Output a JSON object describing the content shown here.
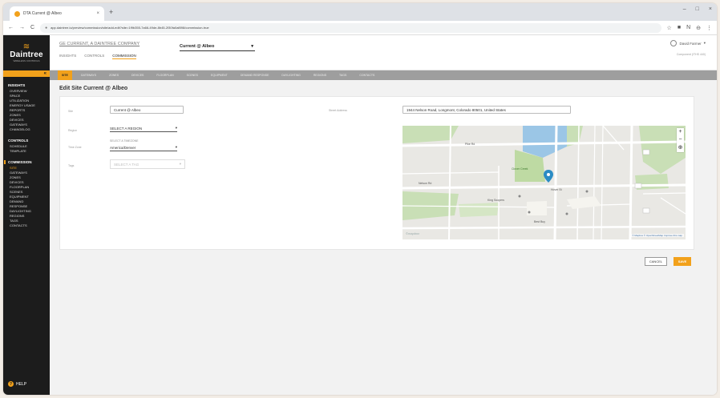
{
  "browser": {
    "tab_title": "DTA Current @ Albeo",
    "tab_close": "×",
    "new_tab": "+",
    "window_controls": [
      "–",
      "□",
      "×"
    ],
    "url": "app.daintree.io/preview/commission/site/add-edit?site=1f9b355-7a66-49de-8b45-2f30fa0af898/commission-true",
    "right_icons": [
      "☆",
      "■",
      "N",
      "⊖",
      "⋮"
    ],
    "nav_icons": [
      "←",
      "→",
      "C"
    ]
  },
  "sidebar": {
    "logo_mark": "≋",
    "brand": "Daintree",
    "tagline": "WIRELESS CONTROLS",
    "collapse_icon": "«",
    "sections": [
      {
        "head": "INSIGHTS",
        "items": [
          "OVERVIEW",
          "SPACE",
          "UTILIZATION",
          "ENERGY USAGE",
          "REPORTS",
          "ZONES",
          "DEVICES",
          "GATEWAYS",
          "CHANGELOG"
        ]
      },
      {
        "head": "CONTROLS",
        "items": [
          "SCHEDULE",
          "TEMPLATE"
        ]
      },
      {
        "head": "COMMISSION",
        "items": [
          "SITE",
          "GATEWAYS",
          "ZONES",
          "DEVICES",
          "FLOORPLAN",
          "SCENES",
          "EQUIPMENT",
          "DEMAND",
          "RESPONSE",
          "DAYLIGHTING",
          "REGIONS",
          "TAGS",
          "CONTACTS"
        ]
      }
    ],
    "help": "HELP",
    "help_icon": "?"
  },
  "topbar": {
    "breadcrumb": "GE CURRENT, A DAINTREE COMPANY",
    "subnav": [
      "INSIGHTS",
      "CONTROLS",
      "COMMISSION"
    ],
    "site_name": "Current @ Albeo",
    "site_caret": "▾",
    "user_name": "David Farmer",
    "user_caret": "▾",
    "company_sub": "Component (ITHS 440)"
  },
  "tabs": [
    "SITE",
    "GATEWAYS",
    "ZONES",
    "DEVICES",
    "FLOORPLAN",
    "SCENES",
    "EQUIPMENT",
    "DEMAND RESPONSE",
    "DAYLIGHTING",
    "REGIONS",
    "TAGS",
    "CONTACTS"
  ],
  "form": {
    "title": "Edit Site Current @ Albeo",
    "name_label": "Site",
    "name_value": "Current @ Albeo",
    "region_label": "Region",
    "region_value": "SELECT A REGION",
    "timezone_label": "Time Zone",
    "timezone_hint": "SELECT A TIMEZONE",
    "timezone_value": "America/Denver",
    "tags_label": "Tags",
    "tags_value": "SELECT A TAG",
    "address_label": "Street Address",
    "address_value": "1944 Nelson Road, Longmont, Colorado 80501, United States",
    "caret": "▾"
  },
  "map": {
    "zoom_in": "+",
    "zoom_out": "−",
    "compass": "⊕",
    "attribution": "© Mapbox © OpenStreetMap  Improve this map",
    "logo": "©mapbox",
    "labels": [
      "Nelson Rd",
      "Hover St",
      "Pike Rd",
      "Clover Creek",
      "King Soopers",
      "Best Buy"
    ]
  },
  "actions": {
    "cancel": "CANCEL",
    "save": "SAVE"
  },
  "colors": {
    "accent": "#f2a11b",
    "sidebar": "#1c1c1c",
    "pin": "#2b8cc4"
  }
}
